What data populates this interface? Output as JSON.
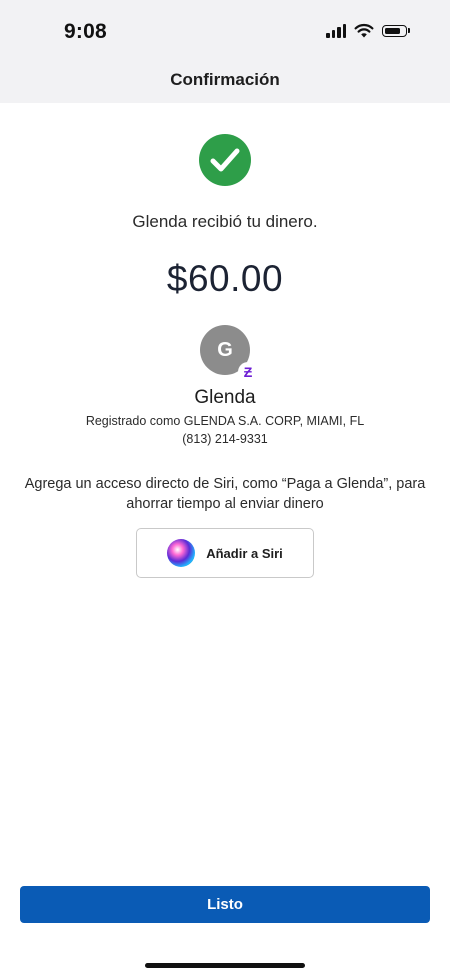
{
  "status_bar": {
    "time": "9:08",
    "icons": [
      "cellular-signal-icon",
      "wifi-icon",
      "battery-icon"
    ]
  },
  "nav": {
    "title": "Confirmación"
  },
  "confirmation": {
    "success_icon": "checkmark-icon",
    "success_color": "#2e9e49",
    "message": "Glenda recibió tu dinero.",
    "amount": "$60.00"
  },
  "recipient": {
    "avatar_initial": "G",
    "badge_icon": "zelle-icon",
    "badge_glyph": "Ƶ",
    "name": "Glenda",
    "registered_as": "Registrado como GLENDA S.A. CORP, MIAMI, FL",
    "phone": "(813) 214-9331"
  },
  "siri": {
    "prompt": "Agrega un acceso directo de Siri, como “Paga a Glenda”, para ahorrar tiempo al enviar dinero",
    "button_label": "Añadir a Siri",
    "icon": "siri-icon"
  },
  "footer": {
    "done_label": "Listo",
    "accent_color": "#0a5bb5"
  }
}
